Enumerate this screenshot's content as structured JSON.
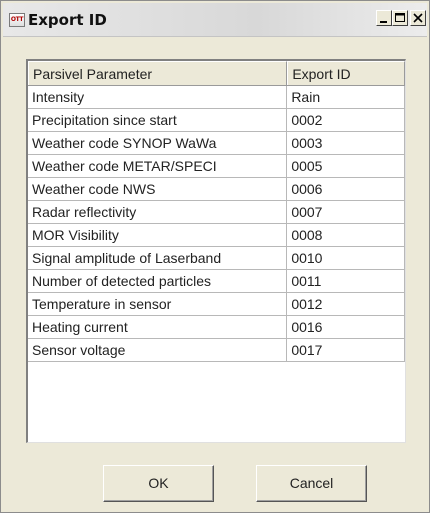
{
  "window": {
    "title": "Export ID",
    "icon_text": "OTT",
    "controls": {
      "minimize": "minimize-icon",
      "maximize": "maximize-icon",
      "close": "close-icon"
    }
  },
  "table": {
    "headers": [
      "Parsivel Parameter",
      "Export ID"
    ],
    "rows": [
      [
        "Intensity",
        "Rain"
      ],
      [
        "Precipitation since start",
        "0002"
      ],
      [
        "Weather code SYNOP WaWa",
        "0003"
      ],
      [
        "Weather code METAR/SPECI",
        "0005"
      ],
      [
        "Weather code NWS",
        "0006"
      ],
      [
        "Radar reflectivity",
        "0007"
      ],
      [
        "MOR Visibility",
        "0008"
      ],
      [
        "Signal amplitude of Laserband",
        "0010"
      ],
      [
        "Number of detected particles",
        "0011"
      ],
      [
        "Temperature in sensor",
        "0012"
      ],
      [
        "Heating current",
        "0016"
      ],
      [
        "Sensor voltage",
        "0017"
      ]
    ]
  },
  "buttons": {
    "ok": "OK",
    "cancel": "Cancel"
  }
}
